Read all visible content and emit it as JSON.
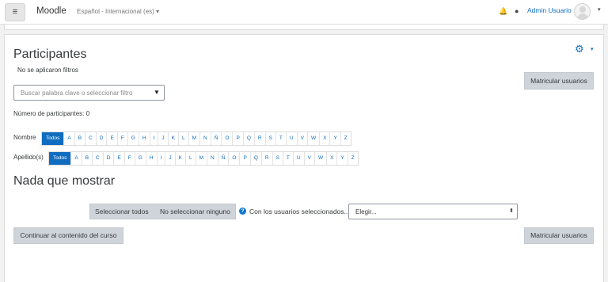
{
  "nav": {
    "menu_icon": "≡",
    "brand": "Moodle",
    "language": "Español - Internacional (es) ▾",
    "user_name": "Admin Usuario",
    "bell_icon": "🔔",
    "chat_icon": "●",
    "caret_icon": "▾"
  },
  "page": {
    "title": "Participantes",
    "no_filters": "No se aplicaron filtros",
    "search_placeholder": "Buscar palabra clave o seleccionar filtro",
    "search_arrow": "▼",
    "participant_count": "Número de participantes: 0",
    "gear_icon": "⚙",
    "gear_caret": "▾",
    "enrol_label": "Matricular usuarios",
    "nothing": "Nada que mostrar",
    "continue_label": "Continuar al contenido del curso"
  },
  "initials": {
    "first_label": "Nombre",
    "last_label": "Apellido(s)",
    "all": "Todos",
    "letters": [
      "A",
      "B",
      "C",
      "D",
      "E",
      "F",
      "G",
      "H",
      "I",
      "J",
      "K",
      "L",
      "M",
      "N",
      "Ñ",
      "O",
      "P",
      "Q",
      "R",
      "S",
      "T",
      "U",
      "V",
      "W",
      "X",
      "Y",
      "Z"
    ]
  },
  "bulk": {
    "select_all": "Seleccionar todos",
    "select_none": "No seleccionar ninguno",
    "help_icon": "?",
    "with_selected": "Con los usuarios seleccionados...",
    "choose": "Elegir...",
    "updown": "⬍"
  },
  "colors": {
    "accent": "#0f6cbf",
    "button": "#ced4da"
  }
}
